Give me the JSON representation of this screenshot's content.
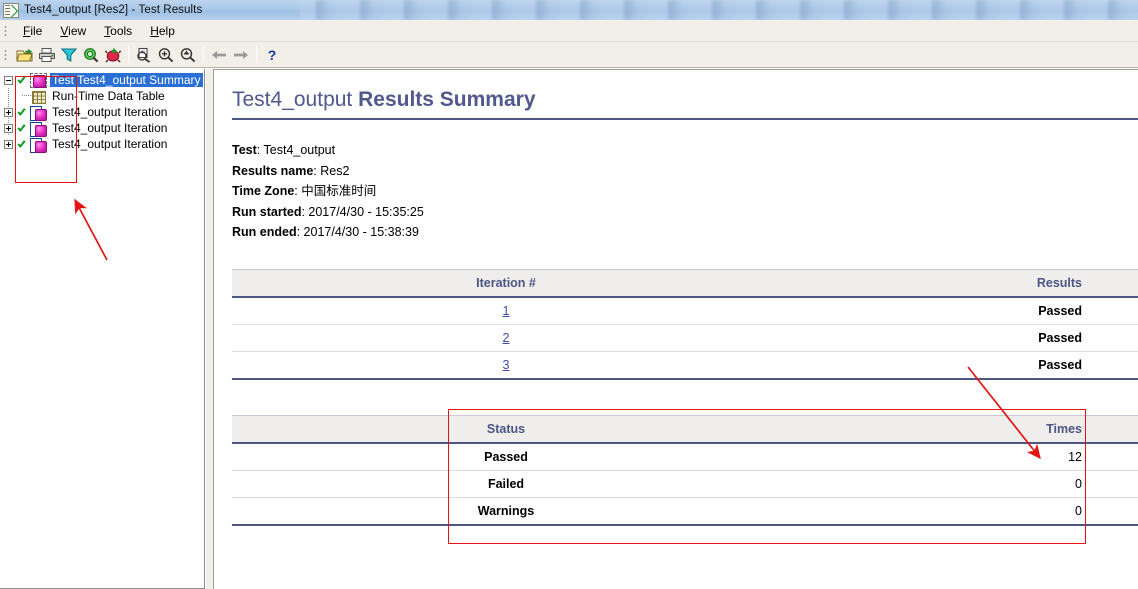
{
  "window": {
    "title": "Test4_output [Res2] - Test Results",
    "icon": "test-results-icon"
  },
  "menu": {
    "items": [
      {
        "label": "File",
        "accel": "F"
      },
      {
        "label": "View",
        "accel": "V"
      },
      {
        "label": "Tools",
        "accel": "T"
      },
      {
        "label": "Help",
        "accel": "H"
      }
    ]
  },
  "toolbar": {
    "buttons": [
      {
        "name": "open-icon",
        "tooltip": "Open"
      },
      {
        "name": "print-icon",
        "tooltip": "Print"
      },
      {
        "name": "filter-icon",
        "tooltip": "Filter"
      },
      {
        "name": "find-icon",
        "tooltip": "Find"
      },
      {
        "name": "defect-icon",
        "tooltip": "Add Defect"
      },
      {
        "name": "zoom-fit-icon",
        "tooltip": "Fit Page"
      },
      {
        "name": "zoom-in-icon",
        "tooltip": "Zoom In"
      },
      {
        "name": "zoom-out-icon",
        "tooltip": "Zoom Out"
      },
      {
        "name": "back-arrow-icon",
        "tooltip": "Back"
      },
      {
        "name": "forward-arrow-icon",
        "tooltip": "Forward"
      },
      {
        "name": "help-question-icon",
        "tooltip": "Help"
      }
    ]
  },
  "tree": {
    "nodes": [
      {
        "label": "Test Test4_output Summary",
        "icon": "cube-icon",
        "status": "passed",
        "expander": "minus",
        "selected": true,
        "indent": 0
      },
      {
        "label": "Run-Time Data Table",
        "icon": "grid-icon",
        "status": "none",
        "expander": "none",
        "selected": false,
        "indent": 1
      },
      {
        "label": "Test4_output Iteration",
        "icon": "page-cube-icon",
        "status": "passed",
        "expander": "plus",
        "selected": false,
        "indent": 0
      },
      {
        "label": "Test4_output Iteration",
        "icon": "page-cube-icon",
        "status": "passed",
        "expander": "plus",
        "selected": false,
        "indent": 0
      },
      {
        "label": "Test4_output Iteration",
        "icon": "page-cube-icon",
        "status": "passed",
        "expander": "plus",
        "selected": false,
        "indent": 0
      }
    ]
  },
  "report": {
    "title_light": "Test4_output ",
    "title_bold": "Results Summary",
    "meta": [
      {
        "label": "Test",
        "value": "Test4_output"
      },
      {
        "label": "Results name",
        "value": "Res2"
      },
      {
        "label": "Time Zone",
        "value": "中国标准时间"
      },
      {
        "label": "Run started",
        "value": "2017/4/30 - 15:35:25"
      },
      {
        "label": "Run ended",
        "value": "2017/4/30 - 15:38:39"
      }
    ],
    "iteration_table": {
      "headers": [
        "Iteration #",
        "Results"
      ],
      "rows": [
        {
          "iteration": "1",
          "result": "Passed",
          "result_state": "pass"
        },
        {
          "iteration": "2",
          "result": "Passed",
          "result_state": "pass"
        },
        {
          "iteration": "3",
          "result": "Passed",
          "result_state": "pass"
        }
      ]
    },
    "status_table": {
      "headers": [
        "Status",
        "Times"
      ],
      "rows": [
        {
          "status": "Passed",
          "status_state": "pass",
          "times": "12"
        },
        {
          "status": "Failed",
          "status_state": "fail",
          "times": "0"
        },
        {
          "status": "Warnings",
          "status_state": "warn",
          "times": "0"
        }
      ]
    }
  },
  "annotations": {
    "color": "#e01515",
    "boxes": [
      {
        "name": "tree-highlight-box"
      },
      {
        "name": "status-table-highlight-box"
      }
    ],
    "arrows": [
      {
        "name": "arrow-to-tree"
      },
      {
        "name": "arrow-to-passed-count"
      }
    ]
  },
  "colors": {
    "accent": "#4d5585",
    "passed": "#0a7a3c",
    "failed": "#d4204a",
    "warnings": "#f0a070",
    "link": "#3b4ea8",
    "selection": "#2a6fd6",
    "annotation": "#e01515"
  }
}
